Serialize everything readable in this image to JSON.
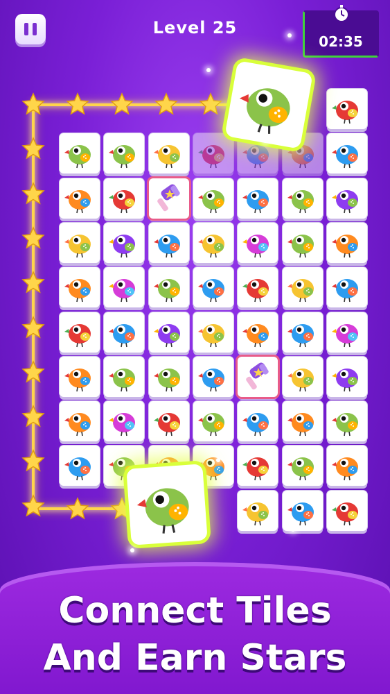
{
  "header": {
    "level_text": "Level  25",
    "timer": "02:35"
  },
  "icons": {
    "pause": "pause-icon",
    "timer": "stopwatch-icon",
    "star": "star-icon",
    "hammer": "hammer-powerup-icon",
    "bird": "bird-icon"
  },
  "colors": {
    "background": "#7a1fd6",
    "star": "#ffd54a",
    "path_glow": "#ffcf3a",
    "timer_border": "#3fd23b",
    "highlight_tile": "#d9ff3a"
  },
  "board": {
    "rows": [
      [
        "",
        "",
        "",
        "",
        "",
        "",
        "red"
      ],
      [
        "green",
        "green",
        "yellow",
        "red",
        "blue",
        "orange",
        "blue"
      ],
      [
        "orange",
        "red",
        "hammer",
        "green",
        "blue",
        "green",
        "purple"
      ],
      [
        "yellow",
        "purple",
        "blue",
        "yellow",
        "magenta",
        "green",
        "orange"
      ],
      [
        "orange",
        "magenta",
        "green",
        "blue",
        "red",
        "yellow",
        "blue"
      ],
      [
        "red",
        "blue",
        "purple",
        "yellow",
        "orange",
        "blue",
        "magenta"
      ],
      [
        "orange",
        "green",
        "green",
        "blue",
        "hammer",
        "yellow",
        "purple"
      ],
      [
        "orange",
        "magenta",
        "red",
        "green",
        "blue",
        "orange",
        "green"
      ],
      [
        "blue",
        "green",
        "orange",
        "orange",
        "red",
        "green",
        "orange"
      ],
      [
        "",
        "",
        "",
        "",
        "yellow",
        "blue",
        "red"
      ]
    ]
  },
  "banner": {
    "line1": "Connect Tiles",
    "line2": "And Earn Stars"
  }
}
